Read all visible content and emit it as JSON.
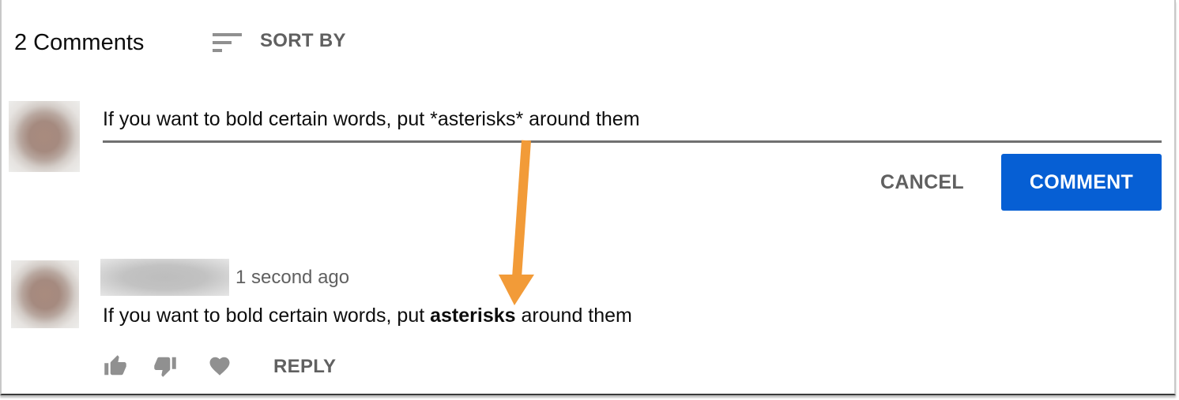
{
  "header": {
    "comment_count": "2 Comments",
    "sort_label": "SORT BY",
    "sort_icon": "sort-icon"
  },
  "composer": {
    "input_value": "If you want to bold certain words, put *asterisks* around them",
    "cancel_label": "CANCEL",
    "comment_label": "COMMENT",
    "comment_button_color": "#065fd4"
  },
  "comments": [
    {
      "username": "",
      "timestamp": "1 second ago",
      "text_before": "If you want to bold certain words, put ",
      "text_bold": "asterisks",
      "text_after": " around them",
      "actions": {
        "like_icon": "thumbs-up-icon",
        "dislike_icon": "thumbs-down-icon",
        "heart_icon": "heart-icon",
        "reply_label": "REPLY"
      }
    }
  ],
  "annotation": {
    "type": "arrow",
    "color": "#f29b38",
    "meaning": "markdown asterisks render as bold text"
  }
}
